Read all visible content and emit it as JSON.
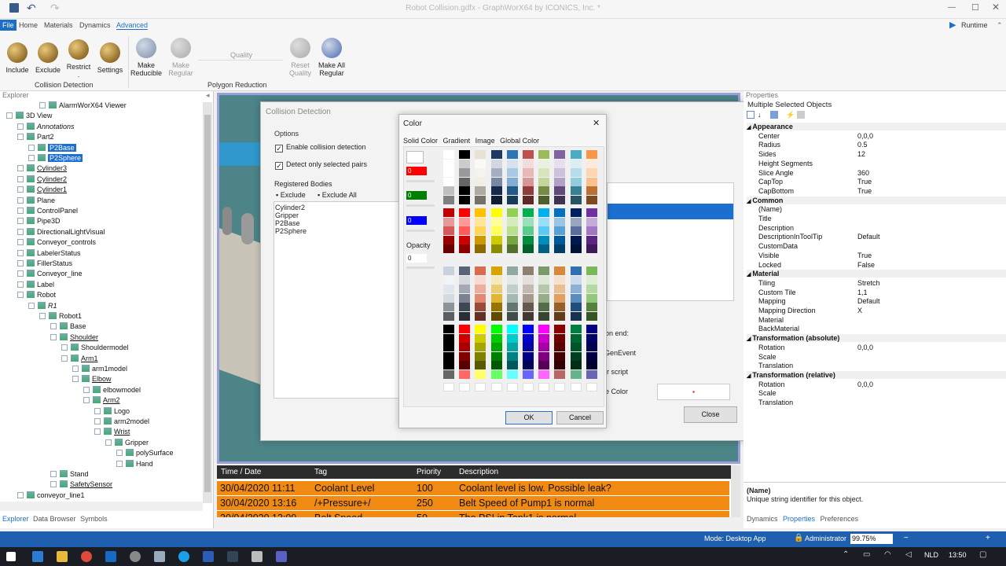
{
  "window": {
    "title": "Robot Collision.gdfx - GraphWorX64 by ICONICS, Inc. *"
  },
  "menu": {
    "file": "File",
    "home": "Home",
    "materials": "Materials",
    "dynamics": "Dynamics",
    "advanced": "Advanced",
    "runtime": "Runtime"
  },
  "ribbon": {
    "include": "Include",
    "exclude": "Exclude",
    "restrict": "Restrict",
    "restrict_dot": ".",
    "settings": "Settings",
    "collision_group": "Collision Detection",
    "make_reducible": "Make Reducible",
    "make_regular": "Make Regular",
    "quality": "Quality",
    "reset_quality": "Reset Quality",
    "make_all_regular": "Make All Regular",
    "polygon_group": "Polygon Reduction"
  },
  "explorer": {
    "title": "Explorer",
    "items": [
      "AlarmWorX64 Viewer",
      "3D View",
      "Annotations",
      "Part2",
      "P2Base",
      "P2Sphere",
      "Cylinder3",
      "Cylinder2",
      "Cylinder1",
      "Plane",
      "ControlPanel",
      "Pipe3D",
      "DirectionalLightVisual",
      "Conveyor_controls",
      "LabelerStatus",
      "FillerStatus",
      "Conveyor_line",
      "Label",
      "Robot",
      "R1",
      "Robot1",
      "Base",
      "Shoulder",
      "Shouldermodel",
      "Arm1",
      "arm1model",
      "Elbow",
      "elbowmodel",
      "Arm2",
      "Logo",
      "arm2model",
      "Wrist",
      "Gripper",
      "polySurface",
      "Hand",
      "Stand",
      "SafetySensor",
      "conveyor_line1"
    ],
    "tabs": [
      "Explorer",
      "Data Browser",
      "Symbols"
    ]
  },
  "collision": {
    "title": "Collision Detection",
    "options": "Options",
    "enable": "Enable collision detection",
    "only_selected": "Detect only selected pairs",
    "registered": "Registered Bodies",
    "exclude": "Exclude",
    "exclude_all": "Exclude All",
    "bodies": [
      "Cylinder2",
      "Gripper",
      "P2Base",
      "P2Sphere"
    ],
    "action_end": "ion end:",
    "genevent": "GenEvent",
    "script": "or script",
    "change_color": "ge Color",
    "close": "Close"
  },
  "color_dialog": {
    "title": "Color",
    "tabs": [
      "Solid Color",
      "Gradient",
      "Image",
      "Global Color"
    ],
    "red": "0",
    "green": "0",
    "blue": "0",
    "opacity_label": "Opacity",
    "opacity": "0",
    "ok": "OK",
    "cancel": "Cancel",
    "palette_top": [
      "#ffffff",
      "#000000",
      "#e8e2d4",
      "#1f3864",
      "#2e75b6",
      "#c0504d",
      "#9bbb59",
      "#8064a2",
      "#4bacc6",
      "#f79646"
    ],
    "palette_std": [
      "#c00000",
      "#ff0000",
      "#ffc000",
      "#ffff00",
      "#92d050",
      "#00b050",
      "#00b0f0",
      "#0070c0",
      "#002060",
      "#7030a0"
    ],
    "palette_mid": [
      "#c8d2dc",
      "#5a6478",
      "#d96c50",
      "#d9a400",
      "#8fa8a0",
      "#908070",
      "#7a9a6a",
      "#d8883a",
      "#3070b0",
      "#7ab85a"
    ],
    "palette_bright": [
      "#000000",
      "#ff0000",
      "#ffff00",
      "#00ff00",
      "#00ffff",
      "#0000ff",
      "#ff00ff",
      "#8b0000",
      "#008040",
      "#000080"
    ]
  },
  "alarm_grid": {
    "headers": [
      "Time / Date",
      "Tag",
      "Priority",
      "Description"
    ],
    "rows": [
      [
        "30/04/2020 11:11",
        "Coolant Level",
        "100",
        "Coolant level is low.  Possible leak?"
      ],
      [
        "30/04/2020 13:16",
        "/+Pressure+/",
        "250",
        "Belt Speed of Pump1 is normal"
      ],
      [
        "30/04/2020 13:09",
        "Belt Speed",
        "50",
        "The PSI in Tank1 is normal"
      ]
    ],
    "row_color": "#f08a12"
  },
  "properties": {
    "title": "Properties",
    "selection": "Multiple Selected Objects",
    "sections": [
      {
        "name": "Appearance",
        "rows": [
          [
            "Center",
            "0,0,0"
          ],
          [
            "Radius",
            "0.5"
          ],
          [
            "Sides",
            "12"
          ],
          [
            "Height Segments",
            ""
          ],
          [
            "Slice Angle",
            "360"
          ],
          [
            "CapTop",
            "True"
          ],
          [
            "CapBottom",
            "True"
          ]
        ]
      },
      {
        "name": "Common",
        "rows": [
          [
            "(Name)",
            ""
          ],
          [
            "Title",
            ""
          ],
          [
            "Description",
            ""
          ],
          [
            "DescriptionInToolTip",
            "Default"
          ],
          [
            "CustomData",
            ""
          ],
          [
            "Visible",
            "True"
          ],
          [
            "Locked",
            "False"
          ]
        ]
      },
      {
        "name": "Material",
        "rows": [
          [
            "Tiling",
            "Stretch"
          ],
          [
            "Custom Tile",
            "1,1"
          ],
          [
            "Mapping",
            "Default"
          ],
          [
            "Mapping Direction",
            "X"
          ],
          [
            "Material",
            ""
          ],
          [
            "BackMaterial",
            ""
          ]
        ]
      },
      {
        "name": "Transformation (absolute)",
        "rows": [
          [
            "Rotation",
            "0,0,0"
          ],
          [
            "Scale",
            ""
          ],
          [
            "Translation",
            ""
          ]
        ]
      },
      {
        "name": "Transformation (relative)",
        "rows": [
          [
            "Rotation",
            "0,0,0"
          ],
          [
            "Scale",
            ""
          ],
          [
            "Translation",
            ""
          ]
        ]
      }
    ],
    "help_title": "(Name)",
    "help_text": "Unique string identifier for this object.",
    "tabs": [
      "Dynamics",
      "Properties",
      "Preferences"
    ]
  },
  "status": {
    "mode": "Mode: Desktop App",
    "user": "Administrator",
    "zoom": "99.75%"
  },
  "taskbar": {
    "lang": "NLD",
    "time": "13:50"
  }
}
